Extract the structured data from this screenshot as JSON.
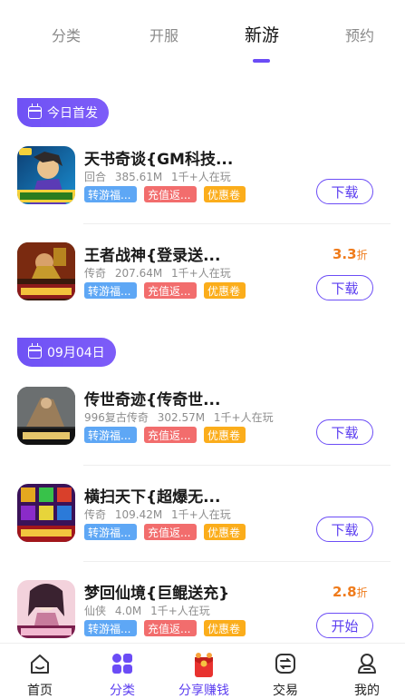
{
  "top_tabs": [
    {
      "label": "分类"
    },
    {
      "label": "开服"
    },
    {
      "label": "新游"
    },
    {
      "label": "预约"
    }
  ],
  "sections": [
    {
      "date_label": "今日首发",
      "games": [
        {
          "title": "天书奇谈{GM科技...",
          "genre": "回合",
          "size": "385.61M",
          "players": "1千+人在玩",
          "tags": [
            "转游福...",
            "充值返...",
            "优惠卷"
          ],
          "discount": "",
          "button": "下载"
        },
        {
          "title": "王者战神{登录送...",
          "genre": "传奇",
          "size": "207.64M",
          "players": "1千+人在玩",
          "tags": [
            "转游福...",
            "充值返...",
            "优惠卷"
          ],
          "discount": "3.3",
          "discount_unit": "折",
          "button": "下载"
        }
      ]
    },
    {
      "date_label": "09月04日",
      "games": [
        {
          "title": "传世奇迹{传奇世...",
          "genre": "996复古传奇",
          "size": "302.57M",
          "players": "1千+人在玩",
          "tags": [
            "转游福...",
            "充值返...",
            "优惠卷"
          ],
          "discount": "",
          "button": "下载"
        },
        {
          "title": "横扫天下{超爆无...",
          "genre": "传奇",
          "size": "109.42M",
          "players": "1千+人在玩",
          "tags": [
            "转游福...",
            "充值返...",
            "优惠卷"
          ],
          "discount": "",
          "button": "下载"
        },
        {
          "title": "梦回仙境{巨鲲送充}",
          "genre": "仙侠",
          "size": "4.0M",
          "players": "1千+人在玩",
          "tags": [
            "转游福...",
            "充值返...",
            "优惠卷"
          ],
          "discount": "2.8",
          "discount_unit": "折",
          "button": "开始"
        }
      ]
    }
  ],
  "bottom_nav": [
    {
      "label": "首页",
      "icon": "home-icon"
    },
    {
      "label": "分类",
      "icon": "grid-icon"
    },
    {
      "label": "分享赚钱",
      "icon": "red-envelope-icon"
    },
    {
      "label": "交易",
      "icon": "trade-icon"
    },
    {
      "label": "我的",
      "icon": "profile-icon"
    }
  ],
  "colors": {
    "accent": "#6b4cf6",
    "discount": "#ef7b1b",
    "tag_blue": "#5ea7f5",
    "tag_red": "#f26d6d",
    "tag_orange": "#fbad1b"
  }
}
